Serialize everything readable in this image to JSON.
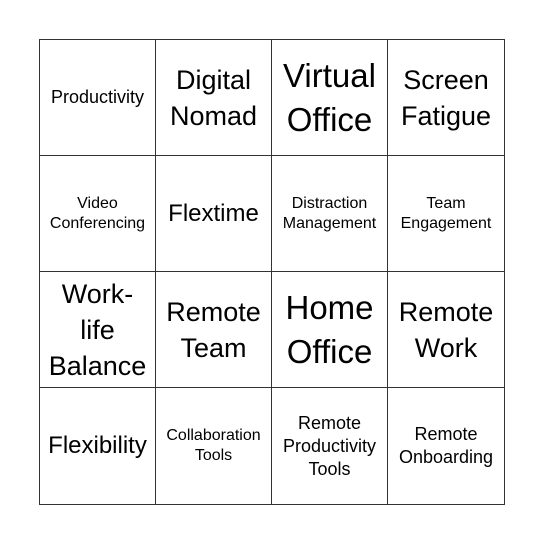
{
  "bingo_card": {
    "rows": [
      [
        "Productivity",
        "Digital Nomad",
        "Virtual Office",
        "Screen Fatigue"
      ],
      [
        "Video Conferencing",
        "Flextime",
        "Distraction Management",
        "Team Engagement"
      ],
      [
        "Work-life Balance",
        "Remote Team",
        "Home Office",
        "Remote Work"
      ],
      [
        "Flexibility",
        "Collaboration Tools",
        "Remote Productivity Tools",
        "Remote Onboarding"
      ]
    ],
    "cells": [
      {
        "lines": [
          "Productivity"
        ]
      },
      {
        "lines": [
          "Digital",
          "Nomad"
        ]
      },
      {
        "lines": [
          "Virtual",
          "Office"
        ]
      },
      {
        "lines": [
          "Screen",
          "Fatigue"
        ]
      },
      {
        "lines": [
          "Video",
          "Conferencing"
        ]
      },
      {
        "lines": [
          "Flextime"
        ]
      },
      {
        "lines": [
          "Distraction",
          "Management"
        ]
      },
      {
        "lines": [
          "Team",
          "Engagement"
        ]
      },
      {
        "lines": [
          "Work-",
          "life",
          "Balance"
        ]
      },
      {
        "lines": [
          "Remote",
          "Team"
        ]
      },
      {
        "lines": [
          "Home",
          "Office"
        ]
      },
      {
        "lines": [
          "Remote",
          "Work"
        ]
      },
      {
        "lines": [
          "Flexibility"
        ]
      },
      {
        "lines": [
          "Collaboration",
          "Tools"
        ]
      },
      {
        "lines": [
          "Remote",
          "Productivity",
          "Tools"
        ]
      },
      {
        "lines": [
          "Remote",
          "Onboarding"
        ]
      }
    ]
  }
}
